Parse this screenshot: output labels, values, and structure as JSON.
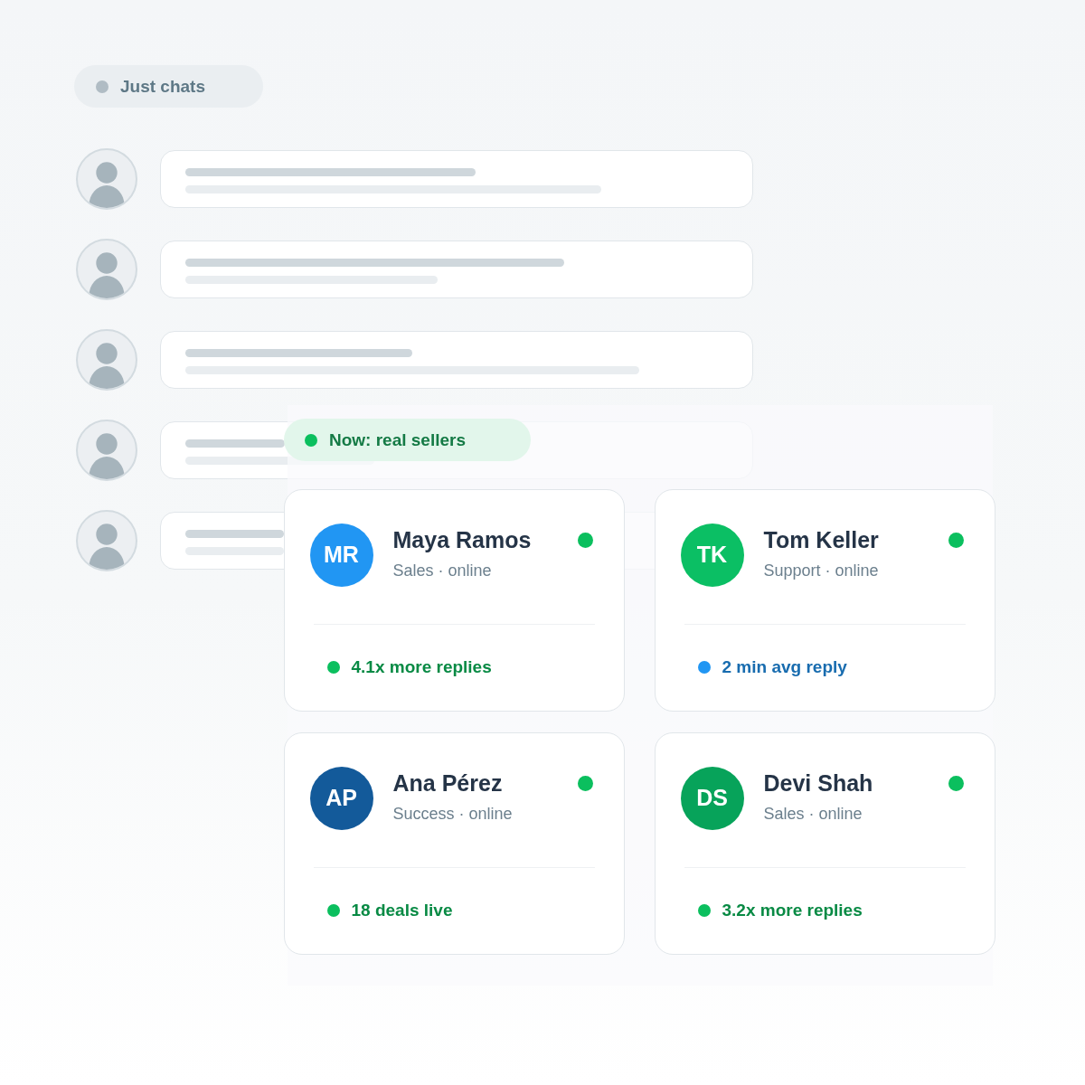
{
  "filter_tag": {
    "label": "Just chats"
  },
  "chat_list": {
    "rows": [
      {
        "kind": "skeleton"
      },
      {
        "kind": "skeleton"
      },
      {
        "kind": "skeleton"
      },
      {
        "kind": "skeleton"
      },
      {
        "kind": "skeleton"
      }
    ]
  },
  "highlight_tag": {
    "label": "Now: real sellers"
  },
  "sellers": [
    {
      "initials": "MR",
      "name": "Maya Ramos",
      "role": "Sales · online",
      "color": "#2196f3",
      "online": true,
      "stat": {
        "label": "4.1x more replies",
        "color": "#0bbf5e"
      }
    },
    {
      "initials": "TK",
      "name": "Tom Keller",
      "role": "Support · online",
      "color": "#0bbf64",
      "online": true,
      "stat": {
        "label": "2 min avg reply",
        "color": "#2196f3"
      }
    },
    {
      "initials": "AP",
      "name": "Ana Pérez",
      "role": "Success · online",
      "color": "#135a9a",
      "online": true,
      "stat": {
        "label": "18 deals live",
        "color": "#0bbf5e"
      }
    },
    {
      "initials": "DS",
      "name": "Devi Shah",
      "role": "Sales · online",
      "color": "#07a35a",
      "online": true,
      "stat": {
        "label": "3.2x more replies",
        "color": "#0bbf5e"
      }
    }
  ]
}
